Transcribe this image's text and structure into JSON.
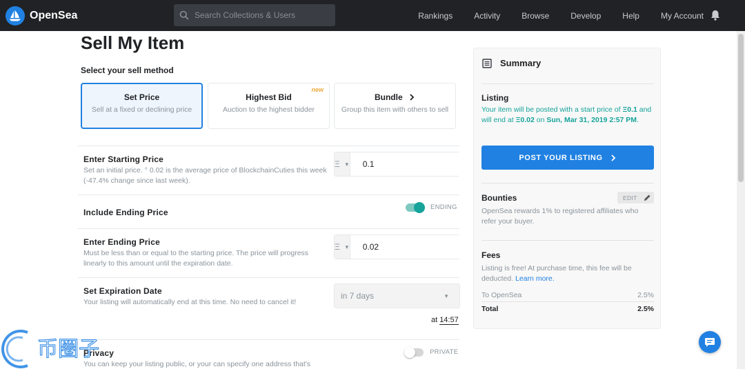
{
  "nav": {
    "brand": "OpenSea",
    "search_placeholder": "Search Collections & Users",
    "links": [
      "Rankings",
      "Activity",
      "Browse",
      "Develop",
      "Help",
      "My Account"
    ]
  },
  "page": {
    "title": "Sell My Item",
    "method_label": "Select your sell method"
  },
  "methods": [
    {
      "title": "Set Price",
      "subtitle": "Sell at a fixed or declining price",
      "selected": true
    },
    {
      "title": "Highest Bid",
      "subtitle": "Auction to the highest bidder",
      "badge": "new"
    },
    {
      "title": "Bundle",
      "subtitle": "Group this item with others to sell"
    }
  ],
  "starting_price": {
    "title": "Enter Starting Price",
    "description": "Set an initial price. ° 0.02 is the average price of BlockchainCuties this week (-47.4% change since last week).",
    "currency": "Ξ",
    "value": "0.1"
  },
  "ending_toggle": {
    "title": "Include Ending Price",
    "label": "ENDING",
    "on": true
  },
  "ending_price": {
    "title": "Enter Ending Price",
    "description": "Must be less than or equal to the starting price. The price will progress linearly to this amount until the expiration date.",
    "currency": "Ξ",
    "value": "0.02"
  },
  "expiration": {
    "title": "Set Expiration Date",
    "description": "Your listing will automatically end at this time. No need to cancel it!",
    "selected": "in 7 days",
    "at_label": "at",
    "time": "14:57"
  },
  "privacy": {
    "title": "Privacy",
    "description": "You can keep your listing public, or your can specify one address that's",
    "label": "PRIVATE",
    "on": false
  },
  "summary": {
    "title": "Summary",
    "listing_title": "Listing",
    "listing_pre": "Your item will be posted with a start price of ",
    "start_price": "Ξ0.1",
    "listing_mid": " and will end at ",
    "end_price": "Ξ0.02",
    "listing_on": " on ",
    "end_date": "Sun, Mar 31, 2019 2:57 PM",
    "listing_end": ".",
    "post_button": "POST YOUR LISTING",
    "bounties_title": "Bounties",
    "edit_label": "EDIT",
    "bounties_text": "OpenSea rewards 1% to registered affiliates who refer your buyer.",
    "fees_title": "Fees",
    "fees_text": "Listing is free! At purchase time, this fee will be deducted. ",
    "learn_more": "Learn more.",
    "fee_rows": [
      {
        "label": "To OpenSea",
        "value": "2.5%"
      },
      {
        "label": "Total",
        "value": "2.5%"
      }
    ]
  },
  "watermark": "币圈子",
  "colors": {
    "brand": "#2081e2",
    "nav_bg": "#202225",
    "green": "#15a39a"
  }
}
